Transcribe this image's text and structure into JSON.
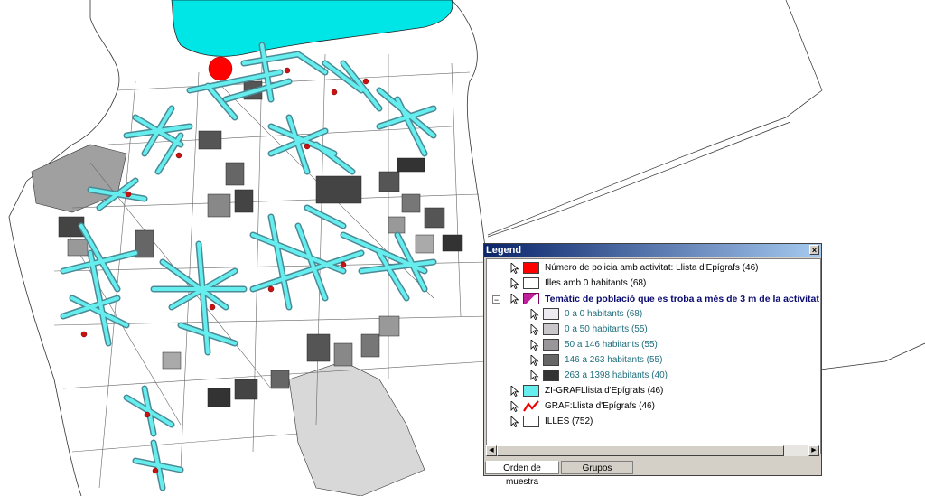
{
  "legend": {
    "title": "Legend",
    "close_glyph": "×",
    "items": [
      {
        "label": "Número de policia amb activitat: Llista d'Epígrafs (46)",
        "swatch": "#ff0000"
      },
      {
        "label": "Illes amb 0 habitants (68)",
        "swatch": "#ffffff"
      },
      {
        "label": "Temàtic de població que es troba a més de  3 m de la activitat",
        "swatch": "thematic"
      },
      {
        "label": "0 a 0 habitants (68)",
        "swatch": "#eeeaf2"
      },
      {
        "label": "0 a 50 habitants (55)",
        "swatch": "#c8c6c8"
      },
      {
        "label": "50 a 146 habitants (55)",
        "swatch": "#989698"
      },
      {
        "label": "146 a 263 habitants (55)",
        "swatch": "#666666"
      },
      {
        "label": "263 a 1398 habitants (40)",
        "swatch": "#333333"
      },
      {
        "label": "ZI-GRAFLlista d'Epígrafs (46)",
        "swatch": "#66eeee"
      },
      {
        "label": "GRAF:Llista d'Epígrafs (46)",
        "swatch": "line"
      },
      {
        "label": "ILLES (752)",
        "swatch": "#ffffff"
      }
    ],
    "expand_glyph": "−",
    "scroll_left_glyph": "◀",
    "scroll_right_glyph": "▶",
    "tabs": [
      {
        "label": "Orden de muestra",
        "active": true
      },
      {
        "label": "Grupos",
        "active": false
      }
    ]
  },
  "colors": {
    "water": "#00e5e5",
    "network": "#66eeee",
    "network_stroke": "#4a8a96",
    "point": "#cc1111",
    "big_point": "#ff0000"
  }
}
